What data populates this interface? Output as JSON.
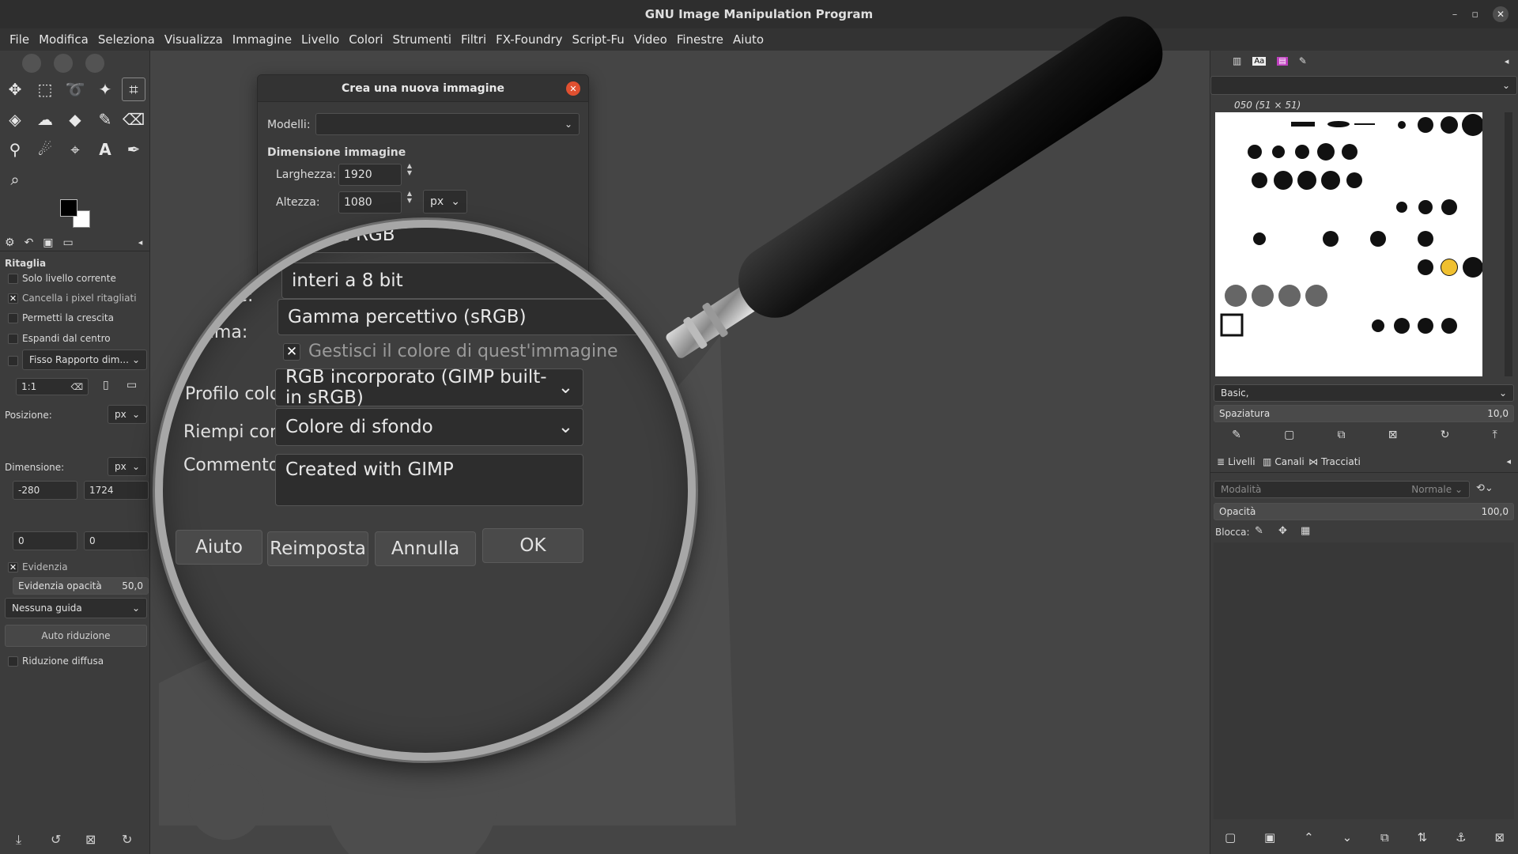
{
  "window": {
    "title": "GNU Image Manipulation Program",
    "minimize": "–",
    "maximize": "▫",
    "close": "✕"
  },
  "menu": [
    "File",
    "Modifica",
    "Seleziona",
    "Visualizza",
    "Immagine",
    "Livello",
    "Colori",
    "Strumenti",
    "Filtri",
    "FX-Foundry",
    "Script-Fu",
    "Video",
    "Finestre",
    "Aiuto"
  ],
  "tool_options": {
    "title": "Ritaglia",
    "only_current_layer": "Solo livello corrente",
    "delete_cropped": "Cancella i pixel ritagliati",
    "allow_growing": "Permetti la crescita",
    "expand_center": "Espandi dal centro",
    "fixed_ratio": "Fisso Rapporto dim...",
    "ratio_value": "1:1",
    "position_label": "Posizione:",
    "position_unit": "px",
    "pos_x": "-280",
    "pos_y": "1724",
    "size_label": "Dimensione:",
    "size_unit": "px",
    "size_w": "0",
    "size_h": "0",
    "highlight": "Evidenzia",
    "highlight_opacity_label": "Evidenzia opacità",
    "highlight_opacity_value": "50,0",
    "guides": "Nessuna guida",
    "auto_shrink": "Auto riduzione",
    "shrink_merged": "Riduzione diffusa"
  },
  "dialog": {
    "title": "Crea una nuova immagine",
    "templates_label": "Modelli:",
    "templates_value": "",
    "image_size_heading": "Dimensione immagine",
    "width_label": "Larghezza:",
    "width_value": "1920",
    "height_label": "Altezza:",
    "height_value": "1080",
    "unit": "px"
  },
  "magnified": {
    "colorspace_value": "Colore RGB",
    "precision_label": "ione:",
    "precision_value": "interi a 8 bit",
    "gamma_label": "amma:",
    "gamma_value": "Gamma percettivo (sRGB)",
    "manage_color": "Gestisci il colore di quest'immagine",
    "profile_label": "Profilo colore:",
    "profile_value": "RGB incorporato (GIMP built-in sRGB)",
    "fill_label": "Riempi con:",
    "fill_value": "Colore di sfondo",
    "comment_label": "Commento:",
    "comment_value": "Created with GIMP",
    "btn_help": "Aiuto",
    "btn_reset": "Reimposta",
    "btn_cancel": "Annulla",
    "btn_ok": "OK"
  },
  "brushes": {
    "current_name": "050 (51 × 51)",
    "tag_value": "Basic,",
    "spacing_label": "Spaziatura",
    "spacing_value": "10,0"
  },
  "layers": {
    "tabs": [
      "Livelli",
      "Canali",
      "Tracciati"
    ],
    "mode_label": "Modalità",
    "mode_value": "Normale",
    "opacity_label": "Opacità",
    "opacity_value": "100,0",
    "lock_label": "Blocca:"
  }
}
